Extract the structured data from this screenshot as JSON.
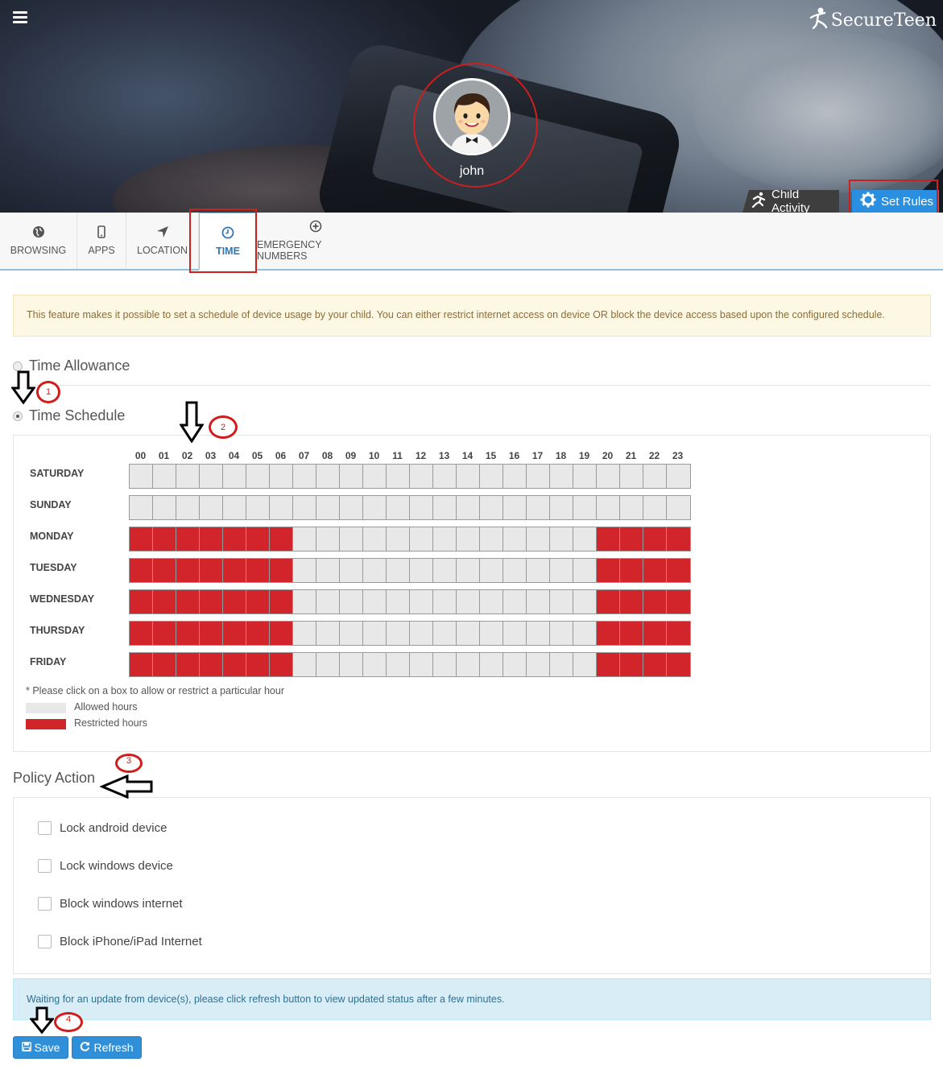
{
  "brand": {
    "name": "SecureTeen"
  },
  "profile": {
    "name": "john"
  },
  "hero_tabs": {
    "child_activity": "Child Activity",
    "set_rules": "Set Rules"
  },
  "tabs": [
    {
      "label": "BROWSING",
      "icon": "globe-icon"
    },
    {
      "label": "APPS",
      "icon": "mobile-icon"
    },
    {
      "label": "LOCATION",
      "icon": "location-arrow-icon"
    },
    {
      "label": "TIME",
      "icon": "clock-icon",
      "active": true
    },
    {
      "label": "EMERGENCY NUMBERS",
      "icon": "plus-circle-icon"
    }
  ],
  "info_text": "This feature makes it possible to set a schedule of device usage by your child. You can either restrict internet access on device OR block the device access based upon the configured schedule.",
  "time_allowance": {
    "label": "Time Allowance",
    "selected": false
  },
  "time_schedule": {
    "label": "Time Schedule",
    "selected": true
  },
  "schedule": {
    "hours": [
      "00",
      "01",
      "02",
      "03",
      "04",
      "05",
      "06",
      "07",
      "08",
      "09",
      "10",
      "11",
      "12",
      "13",
      "14",
      "15",
      "16",
      "17",
      "18",
      "19",
      "20",
      "21",
      "22",
      "23"
    ],
    "days": [
      {
        "name": "SATURDAY",
        "restricted": []
      },
      {
        "name": "SUNDAY",
        "restricted": []
      },
      {
        "name": "MONDAY",
        "restricted": [
          0,
          1,
          2,
          3,
          4,
          5,
          6,
          20,
          21,
          22,
          23
        ]
      },
      {
        "name": "TUESDAY",
        "restricted": [
          0,
          1,
          2,
          3,
          4,
          5,
          6,
          20,
          21,
          22,
          23
        ]
      },
      {
        "name": "WEDNESDAY",
        "restricted": [
          0,
          1,
          2,
          3,
          4,
          5,
          6,
          20,
          21,
          22,
          23
        ]
      },
      {
        "name": "THURSDAY",
        "restricted": [
          0,
          1,
          2,
          3,
          4,
          5,
          6,
          20,
          21,
          22,
          23
        ]
      },
      {
        "name": "FRIDAY",
        "restricted": [
          0,
          1,
          2,
          3,
          4,
          5,
          6,
          20,
          21,
          22,
          23
        ]
      }
    ],
    "note": "* Please click on a box to allow or restrict a particular hour",
    "legend": {
      "allowed": "Allowed hours",
      "restricted": "Restricted hours"
    },
    "colors": {
      "allowed": "#e8e8e8",
      "restricted": "#d2242b"
    }
  },
  "policy": {
    "title": "Policy Action",
    "options": [
      {
        "label": "Lock android device",
        "checked": false
      },
      {
        "label": "Lock windows device",
        "checked": false
      },
      {
        "label": "Block windows internet",
        "checked": false
      },
      {
        "label": "Block iPhone/iPad Internet",
        "checked": false
      }
    ]
  },
  "status_text": "Waiting for an update from device(s), please click refresh button to view updated status after a few minutes.",
  "buttons": {
    "save": "Save",
    "refresh": "Refresh"
  },
  "annotations": [
    "1",
    "2",
    "3",
    "4"
  ]
}
